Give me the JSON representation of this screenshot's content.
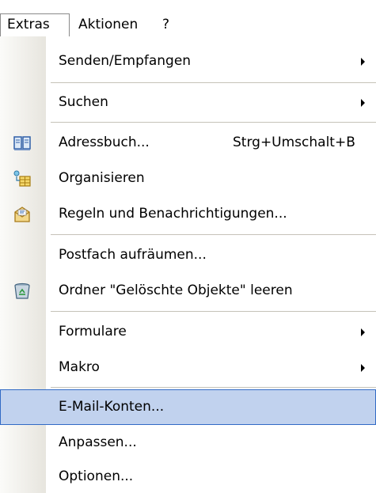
{
  "menubar": {
    "extras": "Extras",
    "aktionen": "Aktionen",
    "help": "?"
  },
  "menu": {
    "items": [
      {
        "label": "Senden/Empfangen",
        "submenu": true
      },
      {
        "label": "Suchen",
        "submenu": true
      },
      {
        "label": "Adressbuch...",
        "shortcut": "Strg+Umschalt+B",
        "icon": "address-book-icon"
      },
      {
        "label": "Organisieren",
        "icon": "organize-icon"
      },
      {
        "label": "Regeln und Benachrichtigungen...",
        "icon": "rules-icon"
      },
      {
        "label": "Postfach aufräumen..."
      },
      {
        "label": "Ordner \"Gelöschte Objekte\" leeren",
        "icon": "recycle-bin-icon"
      },
      {
        "label": "Formulare",
        "submenu": true
      },
      {
        "label": "Makro",
        "submenu": true
      },
      {
        "label": "E-Mail-Konten...",
        "highlighted": true
      },
      {
        "label": "Anpassen..."
      },
      {
        "label": "Optionen..."
      }
    ]
  },
  "colors": {
    "highlight": "#c1d2ee",
    "highlight_border": "#316ac5",
    "gutter": "#e7e5de"
  }
}
